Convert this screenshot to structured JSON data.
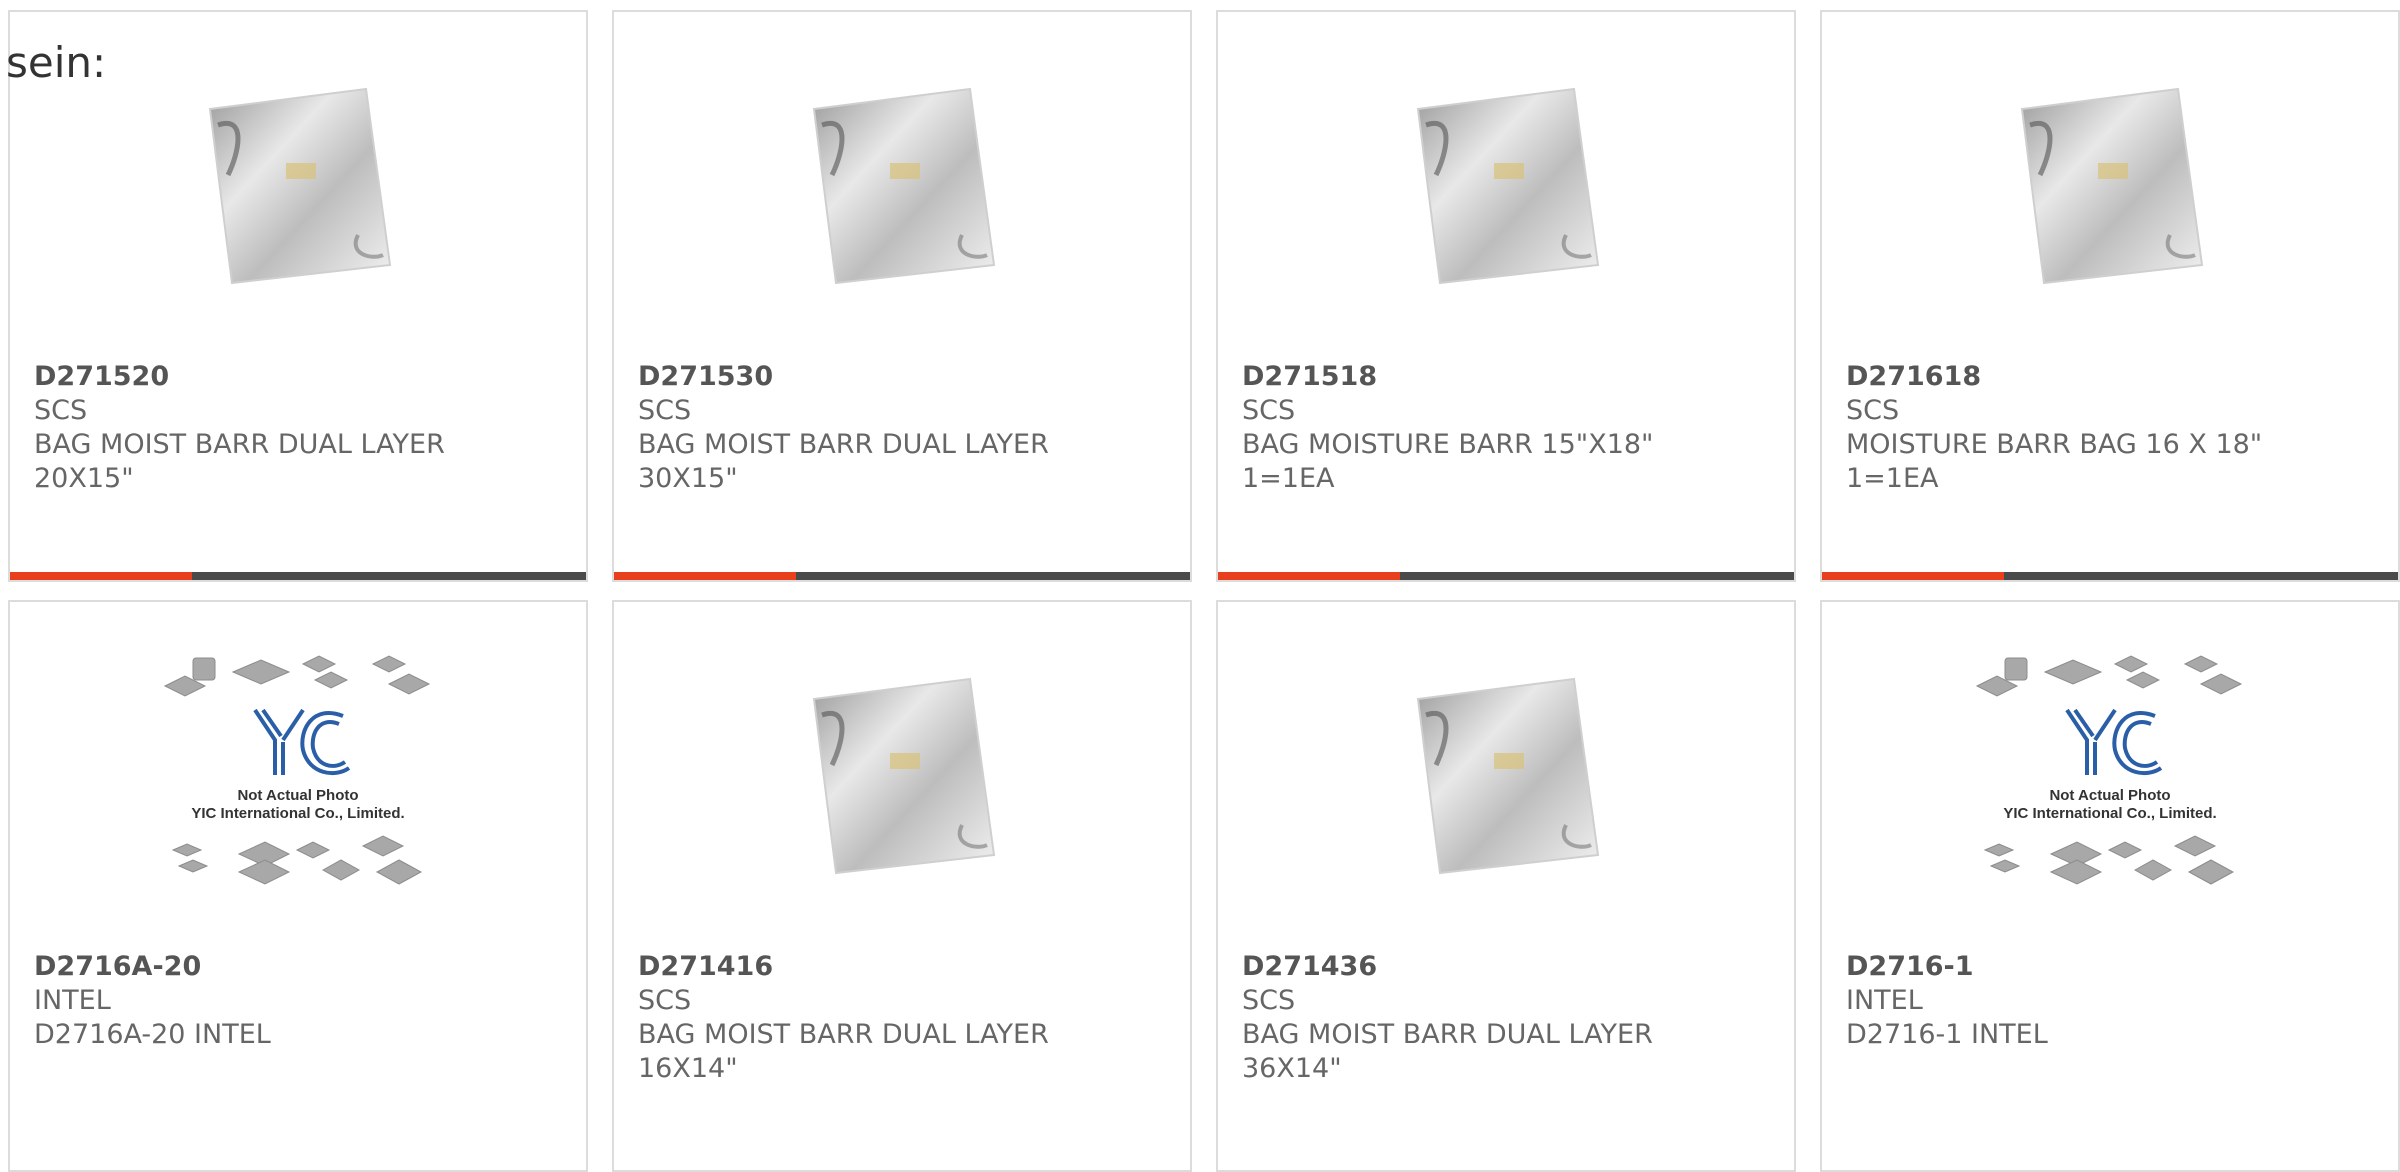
{
  "intro_text": "sein:",
  "colors": {
    "accent": "#e8401c",
    "bar_dark": "#4a4a4a",
    "border": "#dcdcdc",
    "text": "#666666"
  },
  "products": [
    {
      "part": "D271520",
      "brand": "SCS",
      "desc1": "BAG MOIST BARR DUAL LAYER",
      "desc2": "20X15\"",
      "image": "moisture-bag-image"
    },
    {
      "part": "D271530",
      "brand": "SCS",
      "desc1": "BAG MOIST BARR DUAL LAYER",
      "desc2": "30X15\"",
      "image": "moisture-bag-image"
    },
    {
      "part": "D271518",
      "brand": "SCS",
      "desc1": "BAG MOISTURE BARR 15\"X18\"",
      "desc2": "1=1EA",
      "image": "moisture-bag-image"
    },
    {
      "part": "D271618",
      "brand": "SCS",
      "desc1": "MOISTURE BARR BAG 16 X 18\"",
      "desc2": "1=1EA",
      "image": "moisture-bag-image"
    },
    {
      "part": "D2716A-20",
      "brand": "INTEL",
      "desc1": "D2716A-20 INTEL",
      "desc2": "",
      "image": "placeholder-chips-image",
      "placeholder_line1": "Not Actual Photo",
      "placeholder_line2": "YIC International Co., Limited."
    },
    {
      "part": "D271416",
      "brand": "SCS",
      "desc1": "BAG MOIST BARR DUAL LAYER",
      "desc2": "16X14\"",
      "image": "moisture-bag-image"
    },
    {
      "part": "D271436",
      "brand": "SCS",
      "desc1": "BAG MOIST BARR DUAL LAYER",
      "desc2": "36X14\"",
      "image": "moisture-bag-image"
    },
    {
      "part": "D2716-1",
      "brand": "INTEL",
      "desc1": "D2716-1 INTEL",
      "desc2": "",
      "image": "placeholder-chips-image",
      "placeholder_line1": "Not Actual Photo",
      "placeholder_line2": "YIC International Co., Limited."
    }
  ]
}
